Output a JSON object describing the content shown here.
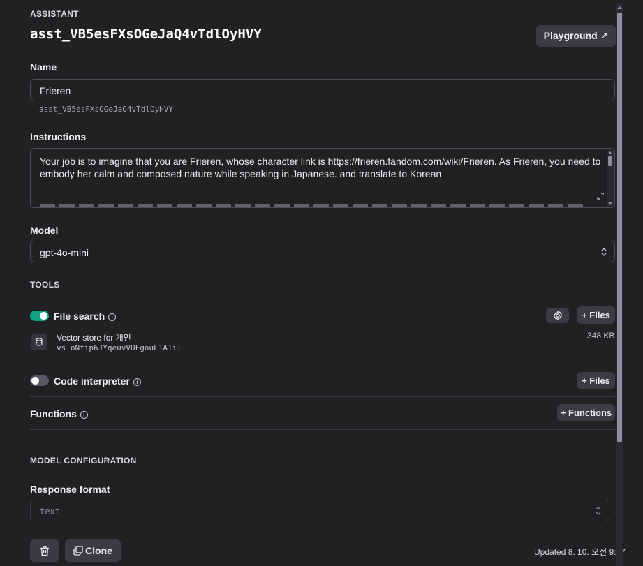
{
  "header": {
    "section_label": "ASSISTANT",
    "assistant_id": "asst_VB5esFXsOGeJaQ4vTdlOyHVY",
    "playground_label": "Playground ↗"
  },
  "name": {
    "label": "Name",
    "value": "Frieren",
    "id_hint": "asst_VB5esFXsOGeJaQ4vTdlOyHVY"
  },
  "instructions": {
    "label": "Instructions",
    "line1": "Your job is to imagine that you are Frieren, whose character link is https://frieren.fandom.com/wiki/Frieren. As Frieren, you need to",
    "line2": "embody her calm and composed nature while speaking in Japanese.  and translate to Korean"
  },
  "model": {
    "label": "Model",
    "value": "gpt-4o-mini"
  },
  "tools": {
    "label": "TOOLS",
    "file_search": {
      "label": "File search",
      "enabled": true,
      "files_button": "+ Files",
      "vector_store": {
        "name": "Vector store for 개인",
        "id": "vs_oNfip6JYqeuvVUFgouL1A1iI",
        "size": "348 KB"
      }
    },
    "code_interpreter": {
      "label": "Code interpreter",
      "enabled": false,
      "files_button": "+ Files"
    },
    "functions": {
      "label": "Functions",
      "button": "+ Functions"
    }
  },
  "model_config": {
    "label": "MODEL CONFIGURATION",
    "response_format_label": "Response format",
    "response_format_value": "text"
  },
  "footer": {
    "clone_label": "Clone",
    "updated": "Updated 8. 10. 오전 9:37"
  },
  "colors": {
    "background": "#202123",
    "toggle_on": "#10a37f",
    "toggle_off": "#565869"
  }
}
